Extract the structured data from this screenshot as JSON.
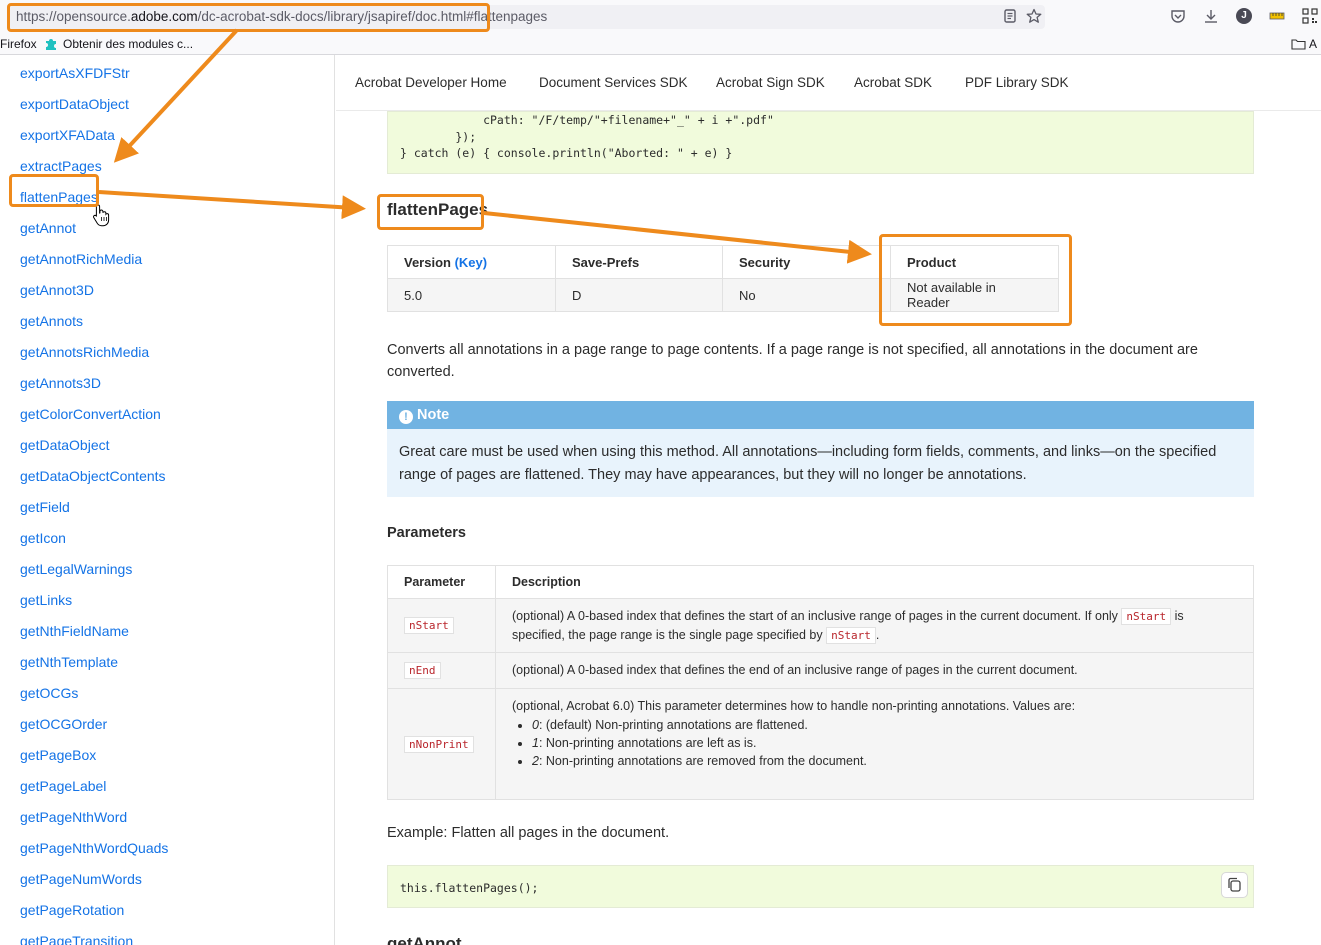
{
  "browser": {
    "url_prefix": "https://opensource.",
    "url_domain": "adobe.com",
    "url_path": "/dc-acrobat-sdk-docs/library/jsapiref/doc.html",
    "url_hash": "#flattenpages",
    "profile_initial": "J",
    "bookmarks": {
      "firefox": "Firefox",
      "modules": "Obtenir des modules c...",
      "right_folder": "A"
    }
  },
  "sidebar": {
    "items": [
      "exportAsXFDFStr",
      "exportDataObject",
      "exportXFAData",
      "extractPages",
      "flattenPages",
      "getAnnot",
      "getAnnotRichMedia",
      "getAnnot3D",
      "getAnnots",
      "getAnnotsRichMedia",
      "getAnnots3D",
      "getColorConvertAction",
      "getDataObject",
      "getDataObjectContents",
      "getField",
      "getIcon",
      "getLegalWarnings",
      "getLinks",
      "getNthFieldName",
      "getNthTemplate",
      "getOCGs",
      "getOCGOrder",
      "getPageBox",
      "getPageLabel",
      "getPageNthWord",
      "getPageNthWordQuads",
      "getPageNumWords",
      "getPageRotation",
      "getPageTransition"
    ]
  },
  "topnav": {
    "items": [
      "Acrobat Developer Home",
      "Document Services SDK",
      "Acrobat Sign SDK",
      "Acrobat SDK",
      "PDF Library SDK"
    ]
  },
  "code_top": {
    "line1": "            cPath: \"/F/temp/\"+filename+\"_\" + i +\".pdf\"",
    "line2": "        });",
    "line3": "} catch (e) { console.println(\"Aborted: \" + e) }"
  },
  "heading": "flattenPages",
  "version_table": {
    "headers": {
      "version": "Version",
      "key": "(Key)",
      "save_prefs": "Save-Prefs",
      "security": "Security",
      "product": "Product"
    },
    "row": {
      "version": "5.0",
      "save_prefs": "D",
      "security": "No",
      "product": "Not available in Reader"
    }
  },
  "description": "Converts all annotations in a page range to page contents. If a page range is not specified, all annotations in the document are converted.",
  "note": {
    "icon_glyph": "!",
    "title": "Note",
    "body": "Great care must be used when using this method. All annotations—including form fields, comments, and links—on the specified range of pages are flattened. They may have appearances, but they will no longer be annotations."
  },
  "parameters": {
    "title": "Parameters",
    "headers": {
      "parameter": "Parameter",
      "description": "Description"
    },
    "rows": [
      {
        "name": "nStart",
        "desc_a": "(optional) A 0-based index that defines the start of an inclusive range of pages in the current document. If only",
        "desc_code1": "nStart",
        "desc_b": "is specified, the page range is the single page specified by",
        "desc_code2": "nStart",
        "desc_c": "."
      },
      {
        "name": "nEnd",
        "desc": "(optional) A 0-based index that defines the end of an inclusive range of pages in the current document."
      },
      {
        "name": "nNonPrint",
        "desc": "(optional, Acrobat 6.0) This parameter determines how to handle non-printing annotations. Values are:",
        "values": [
          {
            "v": "0",
            "text": ": (default) Non-printing annotations are flattened."
          },
          {
            "v": "1",
            "text": ": Non-printing annotations are left as is."
          },
          {
            "v": "2",
            "text": ": Non-printing annotations are removed from the document."
          }
        ]
      }
    ]
  },
  "example": {
    "label": "Example: Flatten all pages in the document.",
    "code": "this.flattenPages();"
  },
  "next_heading": "getAnnot",
  "colors": {
    "annotation": "#ee8a1c",
    "link": "#1473e6",
    "note_header": "#71b3e2",
    "code_bg": "#f1fbdc"
  }
}
